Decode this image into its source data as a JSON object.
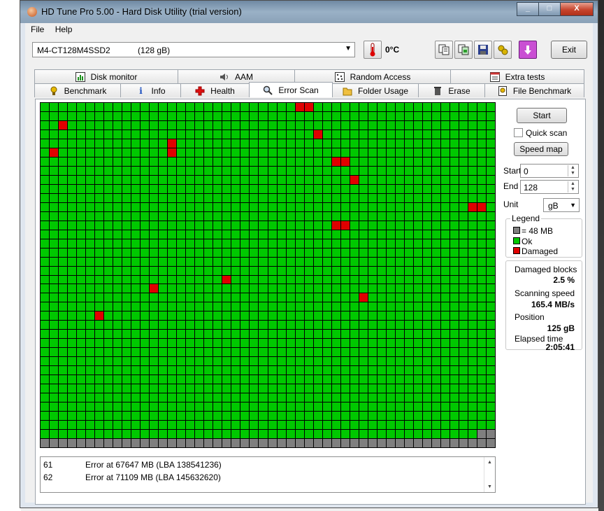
{
  "window": {
    "title": "HD Tune Pro 5.00 - Hard Disk Utility (trial version)",
    "controls": [
      "_",
      "□",
      "X"
    ]
  },
  "menu": [
    "File",
    "Help"
  ],
  "toolbar": {
    "drive": "M4-CT128M4SSD2",
    "drive_size": "(128 gB)",
    "temperature": "0°C",
    "exit_label": "Exit"
  },
  "tabs": {
    "row1": [
      {
        "label": "Disk monitor",
        "icon": "disk-monitor-icon"
      },
      {
        "label": "AAM",
        "icon": "speaker-icon"
      },
      {
        "label": "Random Access",
        "icon": "random-access-icon"
      },
      {
        "label": "Extra tests",
        "icon": "extra-tests-icon"
      }
    ],
    "row2": [
      {
        "label": "Benchmark",
        "icon": "benchmark-icon"
      },
      {
        "label": "Info",
        "icon": "info-icon"
      },
      {
        "label": "Health",
        "icon": "health-cross-icon"
      },
      {
        "label": "Error Scan",
        "icon": "magnifier-icon",
        "active": true
      },
      {
        "label": "Folder Usage",
        "icon": "folder-icon"
      },
      {
        "label": "Erase",
        "icon": "trash-icon"
      },
      {
        "label": "File Benchmark",
        "icon": "file-benchmark-icon"
      }
    ]
  },
  "scan_grid": {
    "columns": 50,
    "rows": 38,
    "colors": {
      "ok": "#00c800",
      "damaged": "#e00000",
      "unscanned": "#7f7f7f"
    },
    "damaged_cells": [
      [
        0,
        28
      ],
      [
        0,
        29
      ],
      [
        2,
        2
      ],
      [
        3,
        30
      ],
      [
        4,
        14
      ],
      [
        5,
        14
      ],
      [
        5,
        1
      ],
      [
        6,
        32
      ],
      [
        6,
        33
      ],
      [
        8,
        34
      ],
      [
        11,
        47
      ],
      [
        11,
        48
      ],
      [
        13,
        32
      ],
      [
        13,
        33
      ],
      [
        19,
        20
      ],
      [
        20,
        12
      ],
      [
        21,
        35
      ],
      [
        23,
        6
      ]
    ],
    "gray_cells": [
      [
        36,
        48
      ],
      [
        36,
        49
      ]
    ],
    "gray_last_row": true
  },
  "controls": {
    "start_label": "Start",
    "quick_scan_label": "Quick scan",
    "speed_map_label": "Speed map",
    "start_field_label": "Start",
    "start_value": "0",
    "end_field_label": "End",
    "end_value": "128",
    "unit_label": "Unit",
    "unit_value": "gB"
  },
  "legend": {
    "title": "Legend",
    "items": [
      {
        "label": "= 48 MB",
        "color": "#7f7f7f"
      },
      {
        "label": "Ok",
        "color": "#00c800"
      },
      {
        "label": "Damaged",
        "color": "#e00000"
      }
    ]
  },
  "stats": {
    "damaged_blocks_label": "Damaged blocks",
    "damaged_blocks_value": "2.5 %",
    "scanning_speed_label": "Scanning speed",
    "scanning_speed_value": "165.4 MB/s",
    "position_label": "Position",
    "position_value": "125 gB",
    "elapsed_label": "Elapsed time",
    "elapsed_value": "2:05:41"
  },
  "log": [
    {
      "num": "61",
      "text": "Error at 67647 MB (LBA 138541236)"
    },
    {
      "num": "62",
      "text": "Error at 71109 MB (LBA 145632620)"
    }
  ]
}
